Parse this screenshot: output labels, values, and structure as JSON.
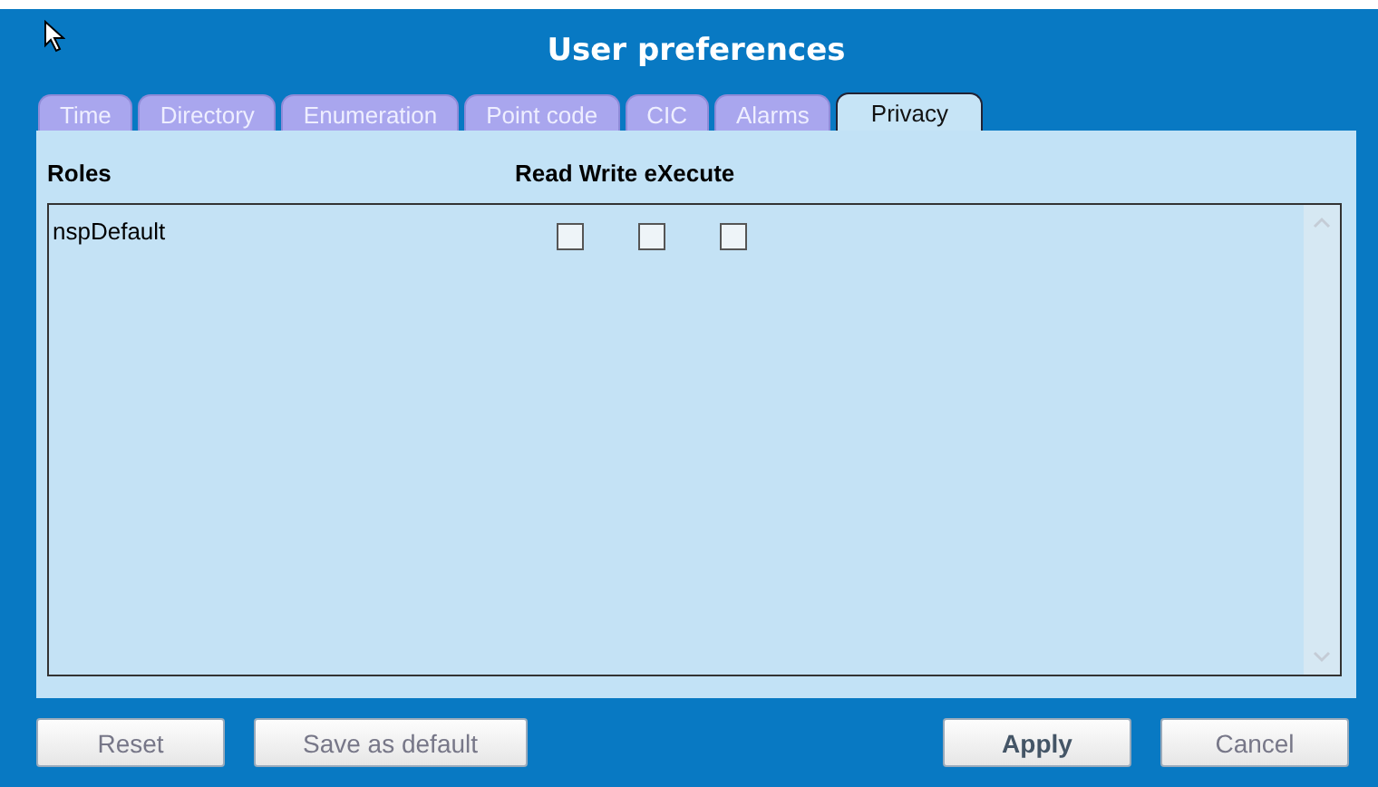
{
  "window": {
    "title": "User preferences"
  },
  "tabs": [
    {
      "label": "Time",
      "selected": false
    },
    {
      "label": "Directory",
      "selected": false
    },
    {
      "label": "Enumeration",
      "selected": false
    },
    {
      "label": "Point code",
      "selected": false
    },
    {
      "label": "CIC",
      "selected": false
    },
    {
      "label": "Alarms",
      "selected": false
    },
    {
      "label": "Privacy",
      "selected": true
    }
  ],
  "table": {
    "columns": [
      "Roles",
      "Read Write eXecute"
    ],
    "rows": [
      {
        "role": "nspDefault",
        "read": false,
        "write": false,
        "execute": false
      }
    ]
  },
  "buttons": [
    {
      "label": "Reset",
      "kind": "normal"
    },
    {
      "label": "Save as default",
      "kind": "normal"
    },
    {
      "label": "Apply",
      "kind": "primary"
    },
    {
      "label": "Cancel",
      "kind": "normal"
    }
  ]
}
